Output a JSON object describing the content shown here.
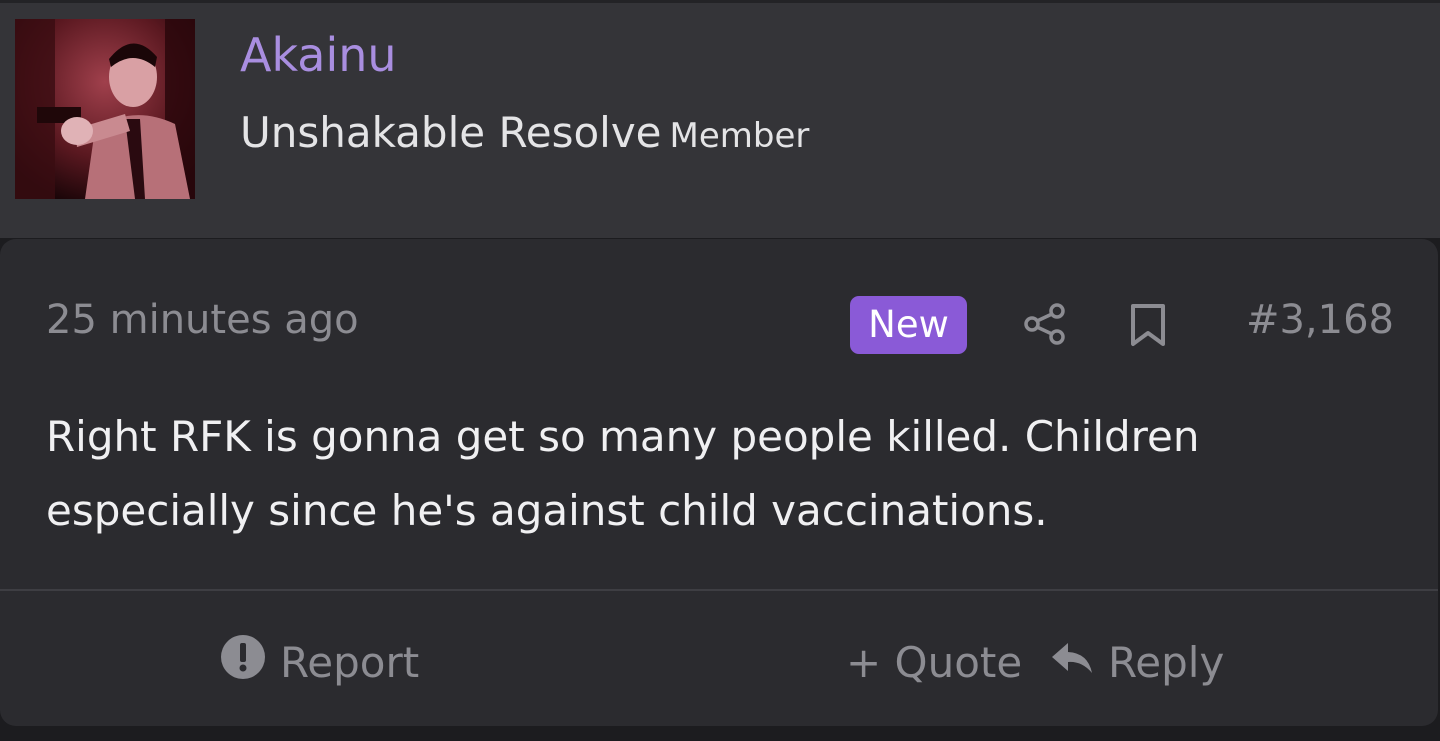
{
  "user": {
    "username": "Akainu",
    "title": "Unshakable Resolve",
    "role": "Member",
    "avatar_icon": "user-avatar-photo",
    "username_color": "#a98ee0"
  },
  "post": {
    "time": "25 minutes ago",
    "badge": "New",
    "badge_color": "#8a5ad7",
    "share_icon": "share-icon",
    "bookmark_icon": "bookmark-icon",
    "number": "#3,168",
    "body_line1": "Right RFK is gonna get so many people killed. Children",
    "body_line2": "especially since he's against child vaccinations."
  },
  "actions": {
    "report_label": "Report",
    "quote_label": "+ Quote",
    "reply_label": "Reply",
    "report_icon": "exclamation-circle-icon",
    "reply_icon": "reply-arrow-icon"
  }
}
